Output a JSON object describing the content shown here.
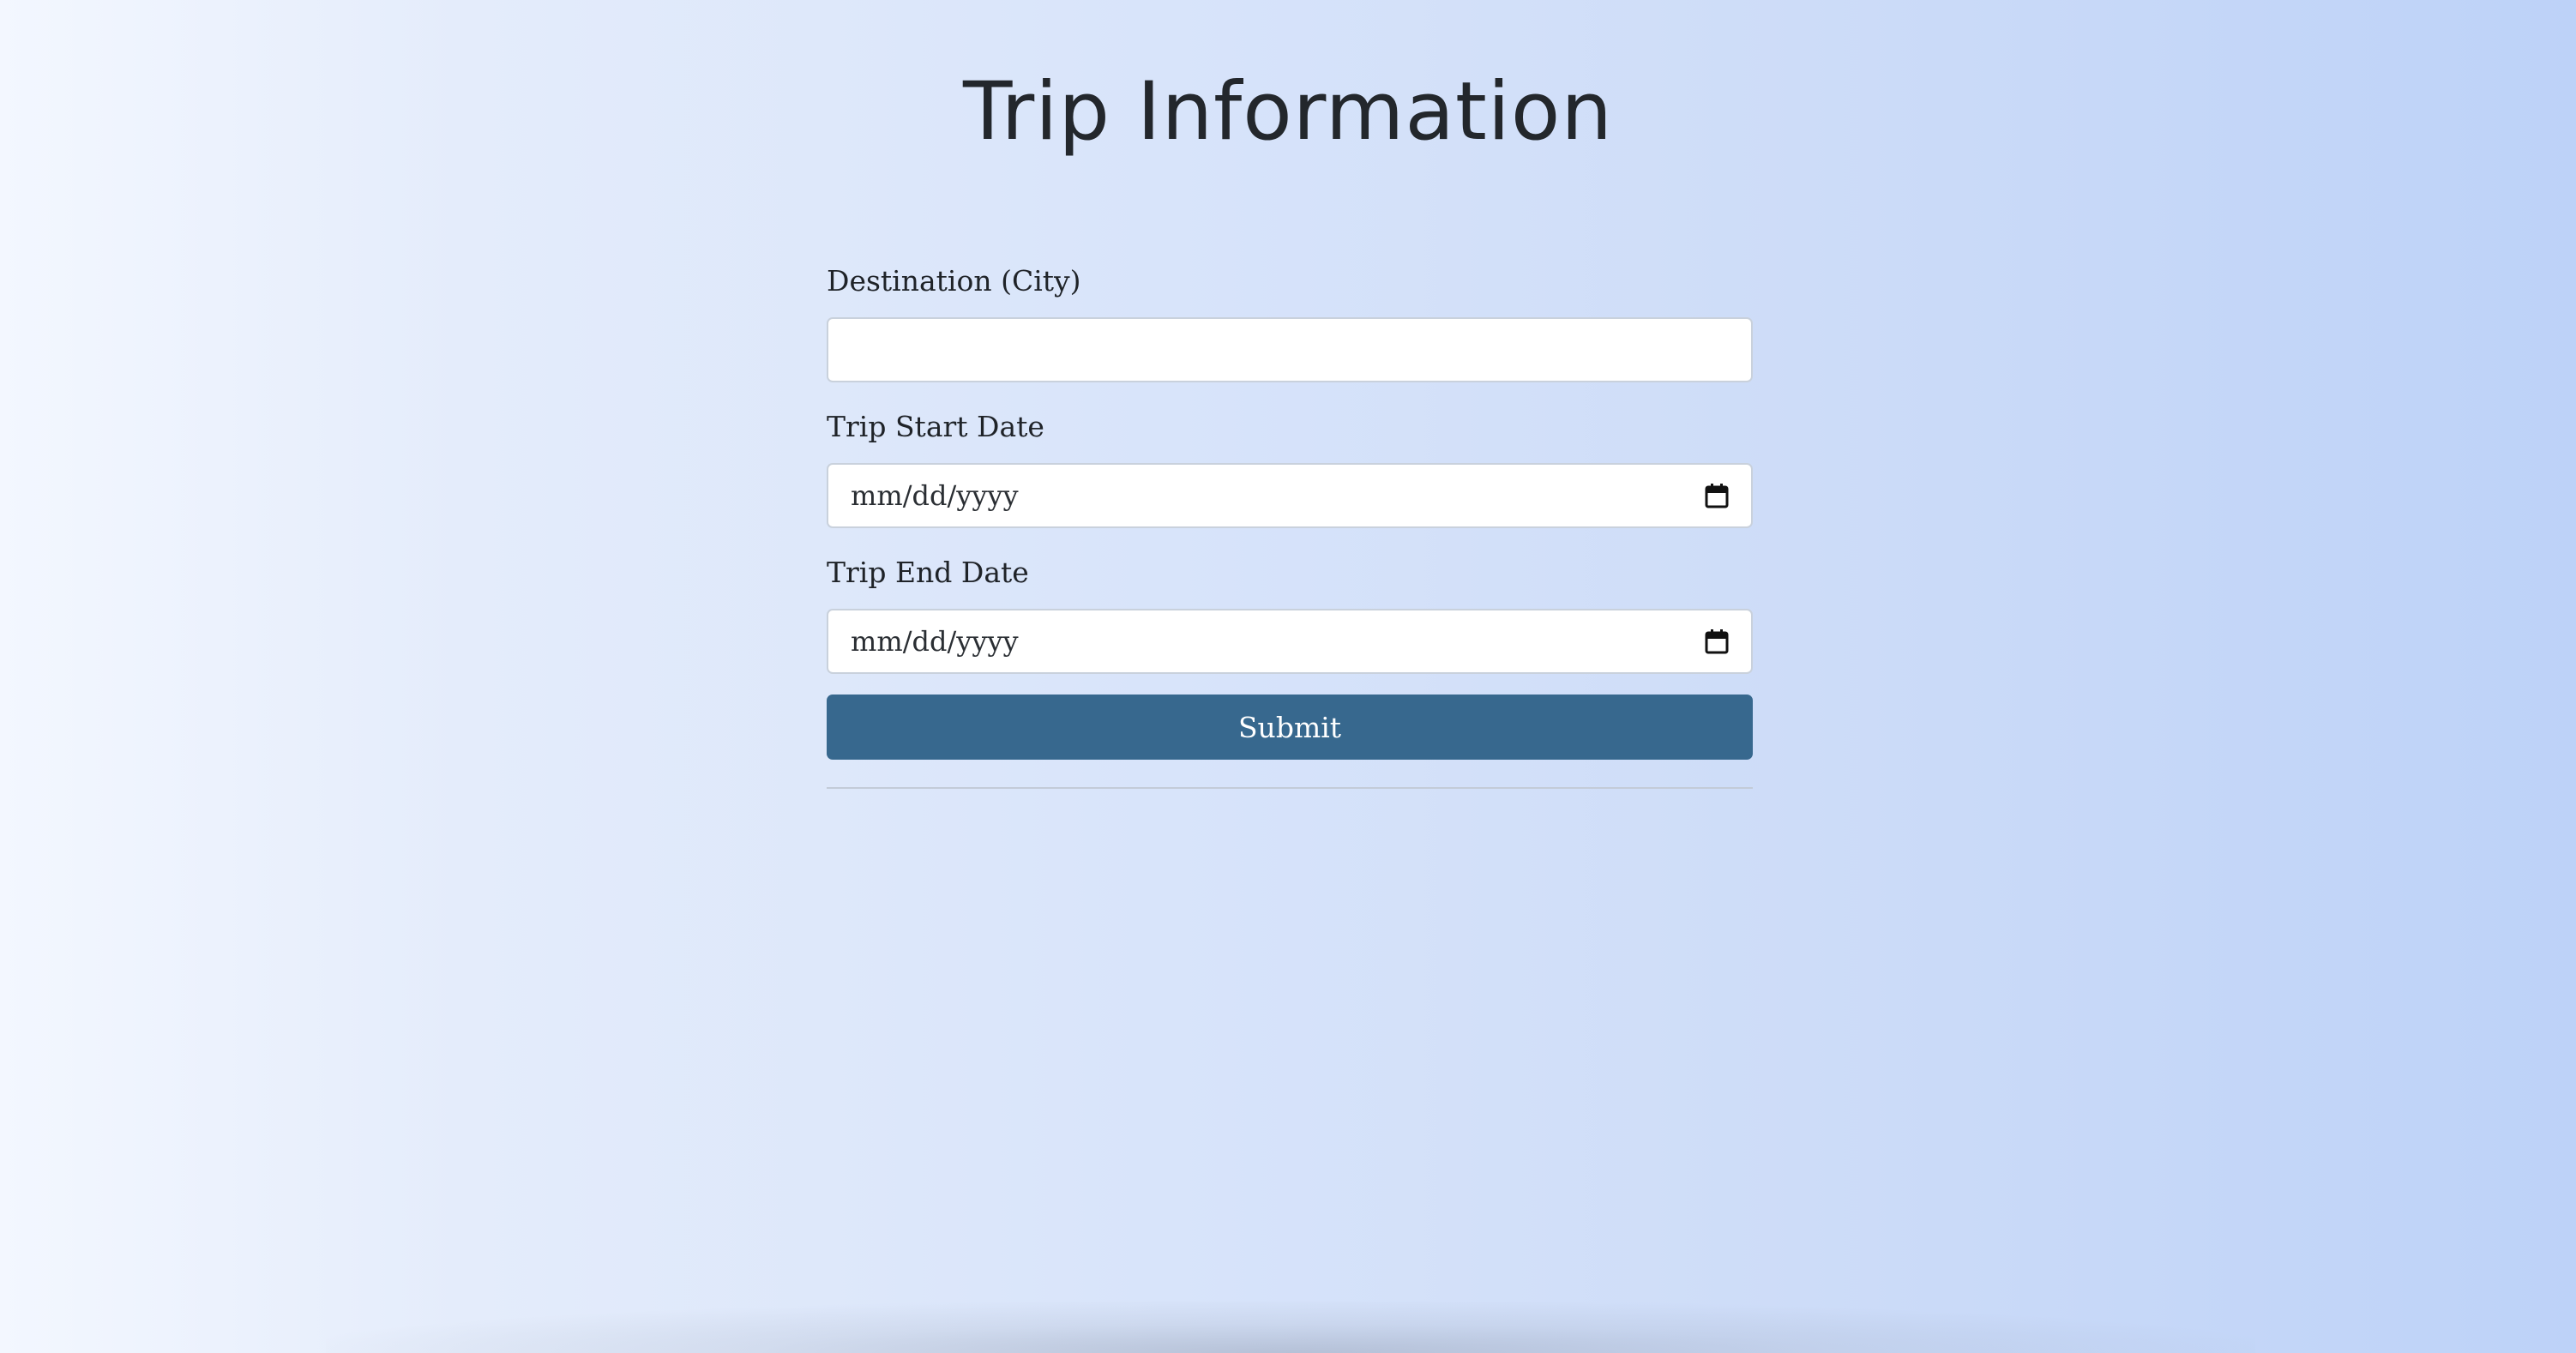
{
  "page": {
    "title": "Trip Information"
  },
  "form": {
    "destination": {
      "label": "Destination (City)",
      "value": ""
    },
    "start_date": {
      "label": "Trip Start Date",
      "placeholder": "mm/dd/yyyy",
      "icon": "calendar-icon"
    },
    "end_date": {
      "label": "Trip End Date",
      "placeholder": "mm/dd/yyyy",
      "icon": "calendar-icon"
    },
    "submit_label": "Submit"
  },
  "colors": {
    "button_bg": "#37688e",
    "background_left": "#f3f7ff",
    "background_right": "#bdd2f8"
  }
}
